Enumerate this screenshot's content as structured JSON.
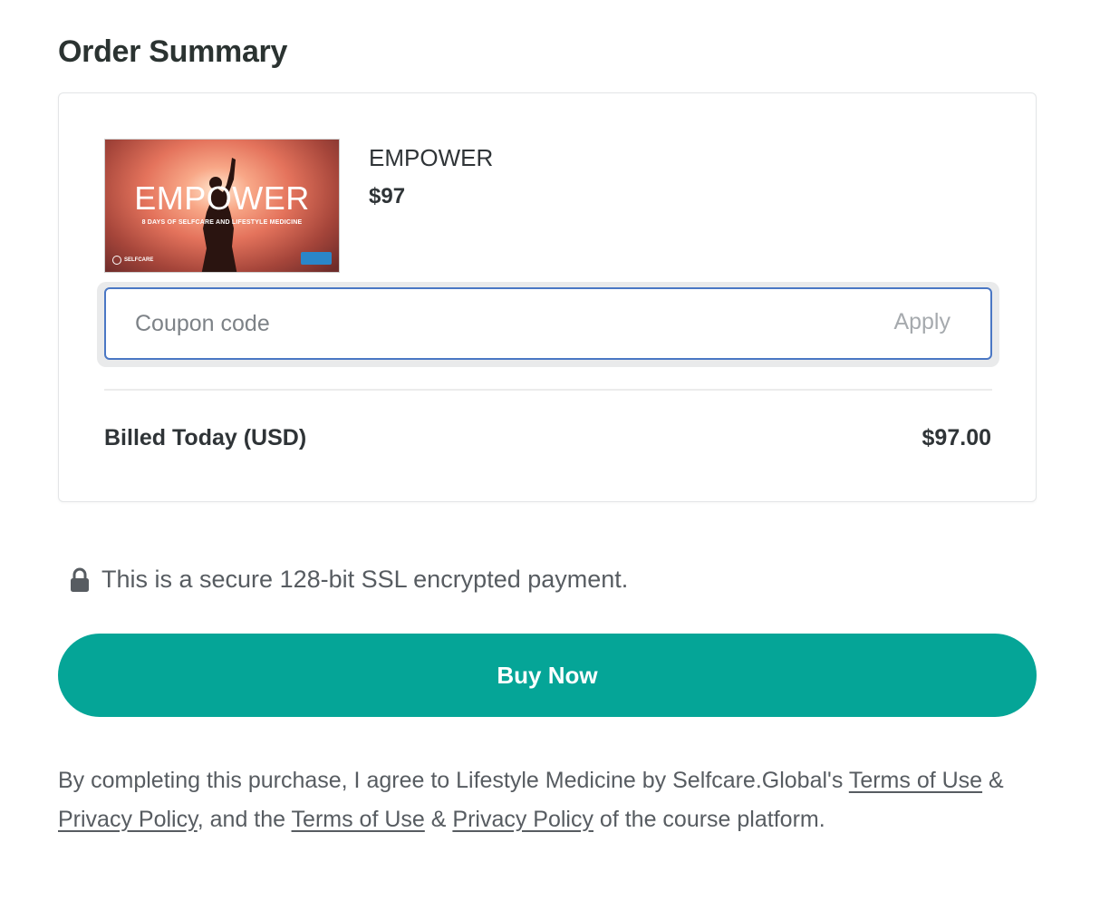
{
  "header": {
    "title": "Order Summary"
  },
  "product": {
    "name": "EMPOWER",
    "price": "$97",
    "thumbnail": {
      "headline": "EMPOWER",
      "subtitle": "8 DAYS OF SELFCARE AND LIFESTYLE MEDICINE",
      "brand": "SELFCARE"
    }
  },
  "coupon": {
    "placeholder": "Coupon code",
    "apply_label": "Apply"
  },
  "billing": {
    "label": "Billed Today (USD)",
    "amount": "$97.00"
  },
  "secure_notice": "This is a secure 128-bit SSL encrypted payment.",
  "buy_button": "Buy Now",
  "legal": {
    "prefix": "By completing this purchase, I agree to Lifestyle Medicine by Selfcare.Global's ",
    "terms_1": "Terms of Use",
    "amp_1": " & ",
    "privacy_1": "Privacy Policy",
    "middle": ", and the ",
    "terms_2": "Terms of Use",
    "amp_2": " & ",
    "privacy_2": "Privacy Policy",
    "suffix": " of the course platform."
  },
  "colors": {
    "accent": "#05a597",
    "focus_border": "#4a77c4",
    "text": "#2f3437"
  }
}
